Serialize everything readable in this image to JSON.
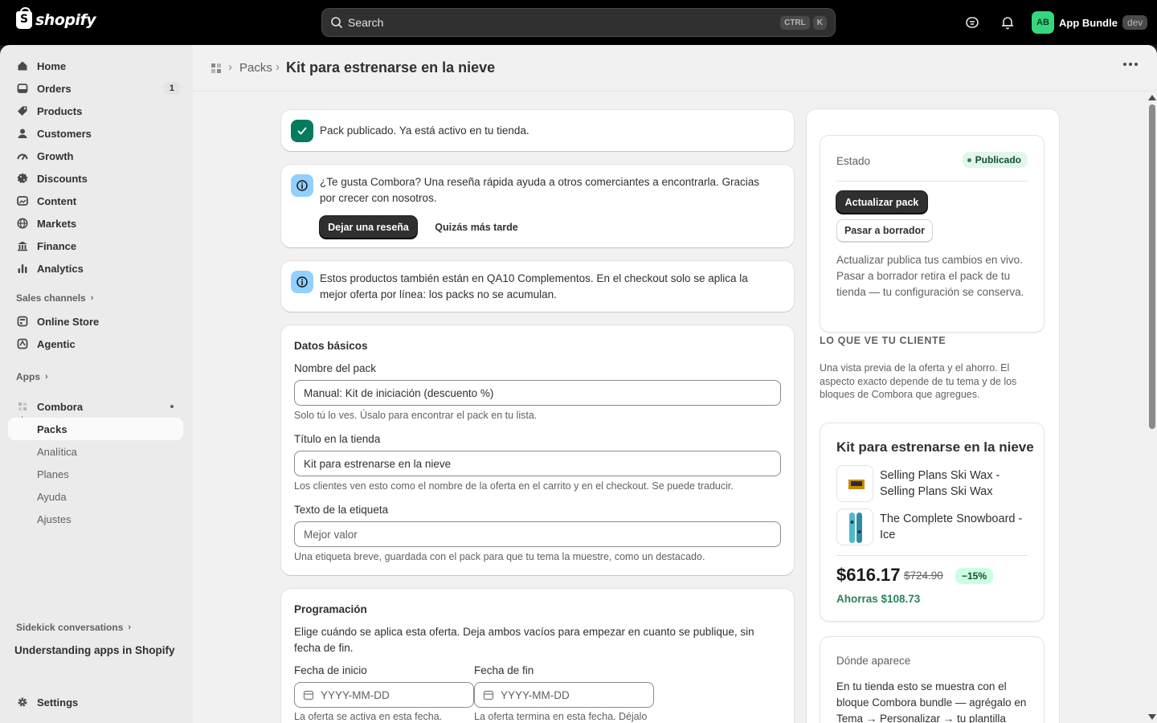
{
  "topbar": {
    "logo_text": "shopify",
    "search_placeholder": "Search",
    "shortcut_ctrl": "CTRL",
    "shortcut_key": "K",
    "app_initials": "AB",
    "app_name": "App Bundle",
    "dev_tag": "dev"
  },
  "sidebar": {
    "items": [
      {
        "label": "Home",
        "icon": "home-icon"
      },
      {
        "label": "Orders",
        "icon": "orders-icon",
        "count": "1"
      },
      {
        "label": "Products",
        "icon": "tag-icon"
      },
      {
        "label": "Customers",
        "icon": "person-icon"
      },
      {
        "label": "Growth",
        "icon": "gauge-icon"
      },
      {
        "label": "Discounts",
        "icon": "discount-icon"
      },
      {
        "label": "Content",
        "icon": "image-icon"
      },
      {
        "label": "Markets",
        "icon": "globe-icon"
      },
      {
        "label": "Finance",
        "icon": "bank-icon"
      },
      {
        "label": "Analytics",
        "icon": "bar-chart-icon"
      }
    ],
    "sales_channels_label": "Sales channels",
    "channels": [
      {
        "label": "Online Store",
        "icon": "store-icon"
      },
      {
        "label": "Agentic",
        "icon": "agentic-icon"
      }
    ],
    "apps_label": "Apps",
    "app": {
      "label": "Combora",
      "icon": "app-grid-icon"
    },
    "app_sub": [
      "Packs",
      "Analítica",
      "Planes",
      "Ayuda",
      "Ajustes"
    ],
    "sidekick_label": "Sidekick conversations",
    "sidekick_item": "Understanding apps in Shopify",
    "settings_label": "Settings"
  },
  "header": {
    "breadcrumb": "Packs",
    "title": "Kit para estrenarse en la nieve"
  },
  "banners": {
    "success": "Pack publicado. Ya está activo en tu tienda.",
    "review_text": "¿Te gusta Combora? Una reseña rápida ayuda a otros comerciantes a encontrarla. Gracias por crecer con nosotros.",
    "review_button": "Dejar una reseña",
    "later_button": "Quizás más tarde",
    "info_text": "Estos productos también están en QA10 Complementos. En el checkout solo se aplica la mejor oferta por línea: los packs no se acumulan."
  },
  "basics": {
    "title": "Datos básicos",
    "name_label": "Nombre del pack",
    "name_value": "Manual: Kit de iniciación (descuento %)",
    "name_help": "Solo tú lo ves. Úsalo para encontrar el pack en tu lista.",
    "store_title_label": "Título en la tienda",
    "store_title_value": "Kit para estrenarse en la nieve",
    "store_title_help": "Los clientes ven esto como el nombre de la oferta en el carrito y en el checkout. Se puede traducir.",
    "tag_label": "Texto de la etiqueta",
    "tag_placeholder": "Mejor valor",
    "tag_help": "Una etiqueta breve, guardada con el pack para que tu tema la muestre, como un destacado."
  },
  "schedule": {
    "title": "Programación",
    "description": "Elige cuándo se aplica esta oferta. Deja ambos vacíos para empezar en cuanto se publique, sin fecha de fin.",
    "start_label": "Fecha de inicio",
    "start_placeholder": "YYYY-MM-DD",
    "start_help": "La oferta se activa en esta fecha.",
    "end_label": "Fecha de fin",
    "end_placeholder": "YYYY-MM-DD",
    "end_help": "La oferta termina en esta fecha. Déjalo"
  },
  "status_card": {
    "label": "Estado",
    "badge": "Publicado",
    "update_button": "Actualizar pack",
    "draft_button": "Pasar a borrador",
    "note": "Actualizar publica tus cambios en vivo. Pasar a borrador retira el pack de tu tienda — tu configuración se conserva."
  },
  "preview": {
    "heading": "LO QUE VE TU CLIENTE",
    "description": "Una vista previa de la oferta y el ahorro. El aspecto exacto depende de tu tema y de los bloques de Combora que agregues.",
    "title": "Kit para estrenarse en la nieve",
    "products": [
      {
        "name": "Selling Plans Ski Wax - Selling Plans Ski Wax"
      },
      {
        "name": "The Complete Snowboard - Ice"
      }
    ],
    "price": "$616.17",
    "old_price": "$724.90",
    "discount": "−15%",
    "savings": "Ahorras $108.73"
  },
  "where": {
    "title": "Dónde aparece",
    "text": "En tu tienda esto se muestra con el bloque Combora bundle — agrégalo en Tema → Personalizar → tu plantilla"
  },
  "colors": {
    "accent_green": "#29845a",
    "info_blue": "#91d0ff",
    "success_green": "#047b5d",
    "dark_button": "#303030"
  }
}
